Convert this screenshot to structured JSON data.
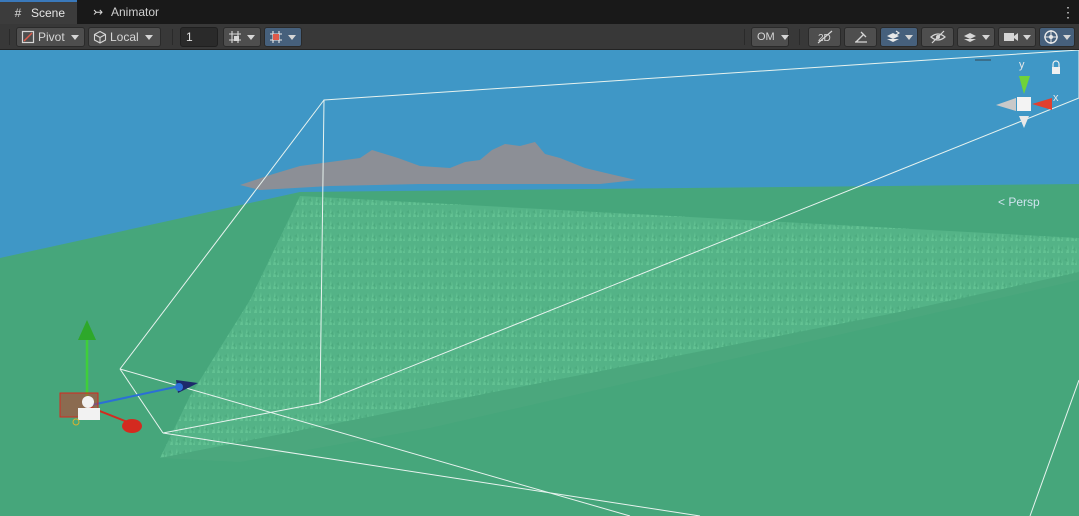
{
  "tabs": [
    {
      "label": "Scene",
      "icon": "grid-icon",
      "active": true
    },
    {
      "label": "Animator",
      "icon": "animator-icon",
      "active": false
    }
  ],
  "toolbar": {
    "pivot_label": "Pivot",
    "local_label": "Local",
    "grid_value": "1",
    "om_label": "OM"
  },
  "gizmo": {
    "y_label": "y",
    "x_label": "x",
    "view_label": "< Persp"
  },
  "colors": {
    "sky": "#3f97c6",
    "ground": "#46a67b",
    "grass": "#57b98a",
    "cloud": "#8c8f96",
    "frustum": "#e8f3ef",
    "axis_x": "#d42a1f",
    "axis_y": "#3fcf3a",
    "axis_z": "#2b6fd6",
    "toolbar_active": "#46607c"
  }
}
